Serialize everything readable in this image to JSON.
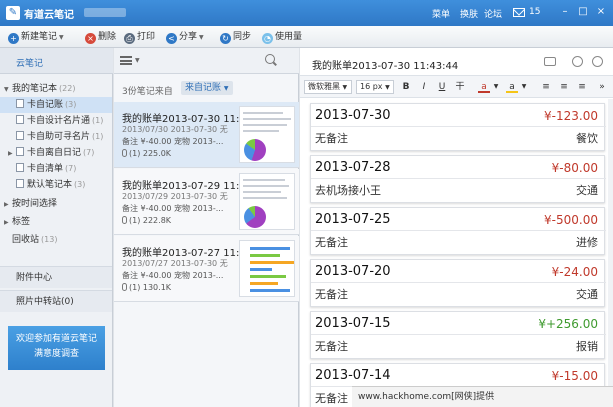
{
  "titlebar": {
    "app_title": "有道云笔记",
    "menu": [
      "菜单",
      "换肤",
      "论坛"
    ],
    "mail_count": "15",
    "minimize": "–",
    "maximize": "□",
    "close": "×"
  },
  "toolbar": {
    "new_note": "新建笔记",
    "delete": "删除",
    "print": "打印",
    "share": "分享",
    "sync": "同步",
    "usage": "使用量"
  },
  "sidebar": {
    "header": "云笔记",
    "my_notebooks": "我的笔记本",
    "my_notebooks_count": "(22)",
    "items": [
      {
        "label": "卡自记账",
        "count": "(3)"
      },
      {
        "label": "卡自设计名片通",
        "count": "(1)"
      },
      {
        "label": "卡自助可寻名片",
        "count": "(1)"
      },
      {
        "label": "卡自离自日记",
        "count": "(7)"
      },
      {
        "label": "卡自清单",
        "count": "(7)"
      },
      {
        "label": "默认笔记本",
        "count": "(3)"
      }
    ],
    "by_time": "按时间选择",
    "tags": "标签",
    "trash": "回收站",
    "trash_count": "(13)",
    "attachments": "附件中心",
    "photo_transfer": "照片中转站(0)",
    "promo_line1": "欢迎参加有道云笔记",
    "promo_line2": "满意度调查"
  },
  "notelist": {
    "count_text": "3份笔记来自",
    "sort_label": "来自记账",
    "notes": [
      {
        "title": "我的账单2013-07-30 11:43...",
        "date": "2013/07/30   2013-07-30 无",
        "snippet": "备注 ¥-40.00 宠物 2013-...",
        "attach": "(1) 225.0K"
      },
      {
        "title": "我的账单2013-07-29 11:27...",
        "date": "2013/07/29   2013-07-30 无",
        "snippet": "备注 ¥-40.00 宠物 2013-...",
        "attach": "(1) 222.8K"
      },
      {
        "title": "我的账单2013-07-27 11:05...",
        "date": "2013/07/27   2013-07-30 无",
        "snippet": "备注 ¥-40.00 宠物 2013-...",
        "attach": "(1) 130.1K"
      }
    ]
  },
  "editor": {
    "title": "我的账单2013-07-30  11:43:44",
    "font_family": "微软雅黑",
    "font_size": "16 px",
    "bold": "B",
    "italic": "I",
    "underline": "U",
    "strike": "干",
    "font_color": "a",
    "highlight": "a",
    "entries": [
      {
        "date": "2013-07-30",
        "amount": "¥-123.00",
        "note": "无备注",
        "category": "餐饮"
      },
      {
        "date": "2013-07-28",
        "amount": "¥-80.00",
        "note": "去机场接小王",
        "category": "交通"
      },
      {
        "date": "2013-07-25",
        "amount": "¥-500.00",
        "note": "无备注",
        "category": "进修"
      },
      {
        "date": "2013-07-20",
        "amount": "¥-24.00",
        "note": "无备注",
        "category": "交通"
      },
      {
        "date": "2013-07-15",
        "amount": "¥+256.00",
        "note": "无备注",
        "category": "报销"
      },
      {
        "date": "2013-07-14",
        "amount": "¥-15.00",
        "note": "无备注",
        "category": "餐饮"
      }
    ]
  },
  "watermark": "www.hackhome.com[网侠]提供"
}
